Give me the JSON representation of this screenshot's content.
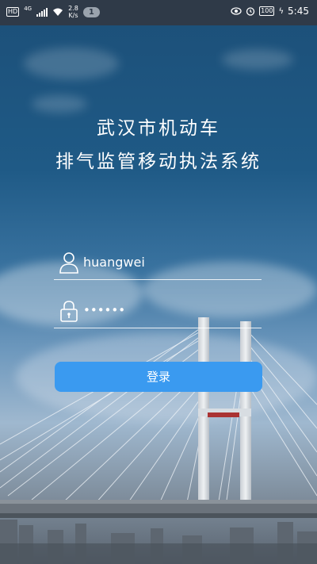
{
  "status_bar": {
    "hd": "HD",
    "network": "4G",
    "speed_value": "2.8",
    "speed_unit": "K/s",
    "notification_count": "1",
    "battery": "100",
    "time": "5:45"
  },
  "app": {
    "title_line1": "武汉市机动车",
    "title_line2": "排气监管移动执法系统"
  },
  "login_form": {
    "username": "huangwei",
    "password_masked": "••••••",
    "login_label": "登录"
  },
  "colors": {
    "accent": "#3a9af0",
    "status_bar_bg": "#2f3a48"
  }
}
